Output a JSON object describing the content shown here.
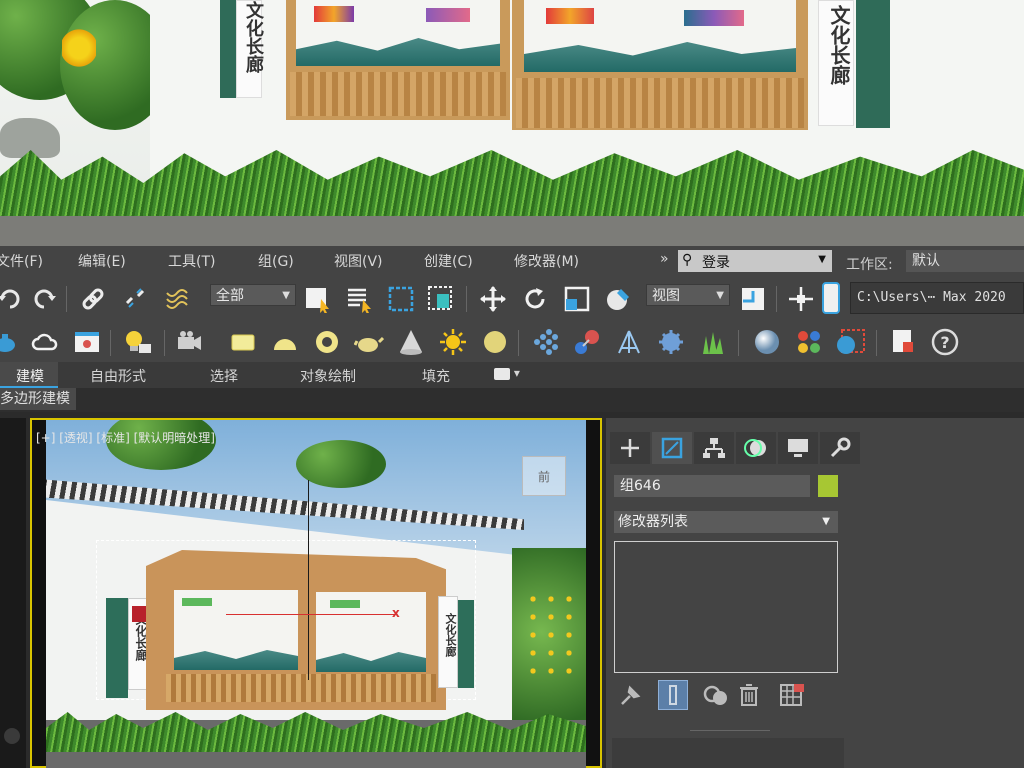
{
  "preview": {
    "board_text_right": "文化长廊",
    "board_text_left": "文化长廊"
  },
  "menu": {
    "items": [
      "文件(F)",
      "编辑(E)",
      "工具(T)",
      "组(G)",
      "视图(V)",
      "创建(C)",
      "修改器(M)"
    ],
    "expand_arrow": "»",
    "login_label": "登录",
    "workspace_label": "工作区:",
    "workspace_value": "默认"
  },
  "toolbar": {
    "selection_filter": "全部",
    "ref_coord": "视图",
    "path_text": "C:\\Users\\⋯ Max 2020"
  },
  "ribbon": {
    "tabs": [
      "建模",
      "自由形式",
      "选择",
      "对象绘制",
      "填充"
    ],
    "sub_tab": "多边形建模"
  },
  "viewport": {
    "label": "[+] [透视] [标准] [默认明暗处理]",
    "viewcube_text": "前",
    "board_text_left": "文化长廊",
    "board_text_right": "文化长廊"
  },
  "command_panel": {
    "object_name": "组646",
    "object_color": "#a7c733",
    "modifier_list": "修改器列表"
  },
  "colors": {
    "ui_bg": "#444444",
    "viewport_border": "#d8c400",
    "accent_blue": "#3aa3e0"
  }
}
